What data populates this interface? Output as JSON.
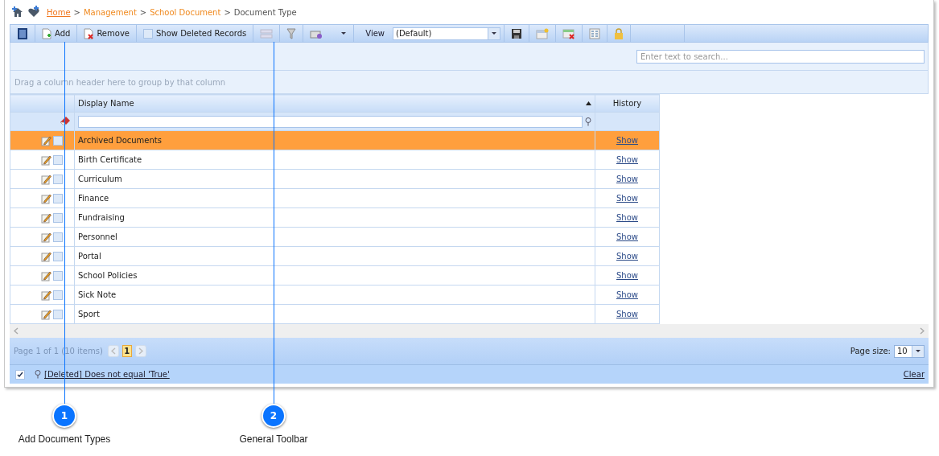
{
  "breadcrumb": [
    {
      "label": "Home",
      "kind": "link"
    },
    {
      "label": "Management",
      "kind": "crumb"
    },
    {
      "label": "School Document",
      "kind": "crumb"
    },
    {
      "label": "Document Type",
      "kind": "current"
    }
  ],
  "breadcrumb_separator": ">",
  "toolbar": {
    "add": "Add",
    "remove": "Remove",
    "show_deleted": {
      "label": "Show Deleted Records",
      "checked": false
    },
    "view_label": "View",
    "view_value": "(Default)"
  },
  "search": {
    "placeholder": "Enter text to search..."
  },
  "group_hint": "Drag a column header here to group by that column",
  "table": {
    "columns": [
      "Display Name",
      "History"
    ],
    "rows": [
      {
        "name": "Archived Documents",
        "history": "Show",
        "selected": true,
        "checked": false
      },
      {
        "name": "Birth Certificate",
        "history": "Show",
        "selected": false,
        "checked": false
      },
      {
        "name": "Curriculum",
        "history": "Show",
        "selected": false,
        "checked": false
      },
      {
        "name": "Finance",
        "history": "Show",
        "selected": false,
        "checked": false
      },
      {
        "name": "Fundraising",
        "history": "Show",
        "selected": false,
        "checked": false
      },
      {
        "name": "Personnel",
        "history": "Show",
        "selected": false,
        "checked": false
      },
      {
        "name": "Portal",
        "history": "Show",
        "selected": false,
        "checked": false
      },
      {
        "name": "School Policies",
        "history": "Show",
        "selected": false,
        "checked": false
      },
      {
        "name": "Sick Note",
        "history": "Show",
        "selected": false,
        "checked": false
      },
      {
        "name": "Sport",
        "history": "Show",
        "selected": false,
        "checked": false
      }
    ]
  },
  "pager": {
    "info": "Page 1 of 1 (10 items)",
    "current_page": "1",
    "page_size_label": "Page size:",
    "page_size": "10"
  },
  "filter_bar": {
    "enabled": true,
    "expression": "[Deleted] Does not equal 'True'",
    "clear": "Clear"
  },
  "callouts": [
    {
      "number": "1",
      "label": "Add Document Types"
    },
    {
      "number": "2",
      "label": "General Toolbar"
    }
  ]
}
